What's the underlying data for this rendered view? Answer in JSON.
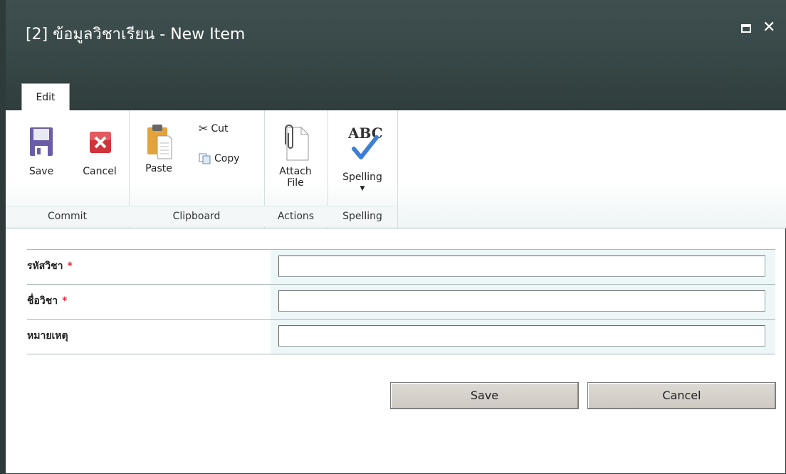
{
  "dialog": {
    "title": "[2] ข้อมูลวิชาเรียน - New Item",
    "maximize_symbol": "",
    "close_symbol": "✕"
  },
  "ribbon": {
    "active_tab": "Edit",
    "groups": {
      "commit": {
        "label": "Commit",
        "save": "Save",
        "cancel": "Cancel"
      },
      "clipboard": {
        "label": "Clipboard",
        "paste": "Paste",
        "cut": "Cut",
        "copy": "Copy"
      },
      "actions": {
        "label": "Actions",
        "attach_line1": "Attach",
        "attach_line2": "File"
      },
      "spelling": {
        "label": "Spelling",
        "spelling": "Spelling",
        "abc": "ABC"
      }
    }
  },
  "form": {
    "fields": [
      {
        "label": "รหัสวิชา",
        "required": true,
        "value": ""
      },
      {
        "label": "ชื่อวิชา",
        "required": true,
        "value": ""
      },
      {
        "label": "หมายเหตุ",
        "required": false,
        "value": ""
      }
    ],
    "required_mark": "*",
    "save_label": "Save",
    "cancel_label": "Cancel"
  },
  "colors": {
    "titlebar": "#3a4949",
    "required": "#ee2233",
    "field_bg": "#eef7f7"
  }
}
